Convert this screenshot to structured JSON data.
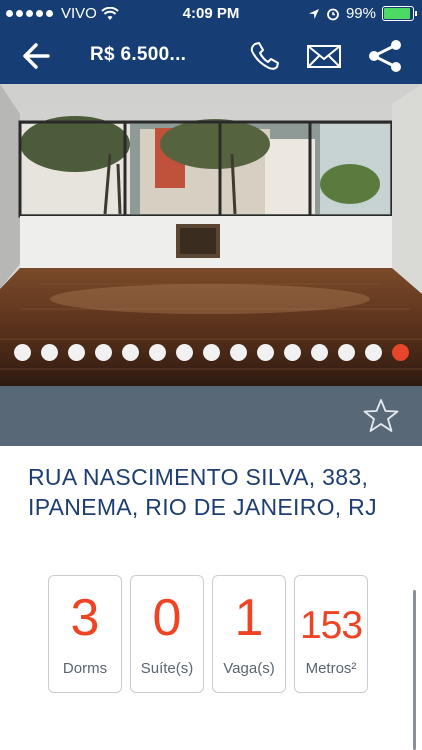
{
  "status_bar": {
    "carrier": "VIVO",
    "time": "4:09 PM",
    "battery": "99%"
  },
  "nav": {
    "title": "R$ 6.500..."
  },
  "gallery": {
    "total_images": 15,
    "active_index": 14
  },
  "listing": {
    "address_line1": "RUA NASCIMENTO SILVA, 383,",
    "address_line2": "IPANEMA, RIO DE JANEIRO, RJ"
  },
  "stats": [
    {
      "value": "3",
      "label": "Dorms"
    },
    {
      "value": "0",
      "label": "Suíte(s)"
    },
    {
      "value": "1",
      "label": "Vaga(s)"
    },
    {
      "value": "153",
      "label": "Metros²"
    }
  ],
  "colors": {
    "brand": "#163e74",
    "accent": "#ee4423",
    "action_bar": "#596877"
  }
}
